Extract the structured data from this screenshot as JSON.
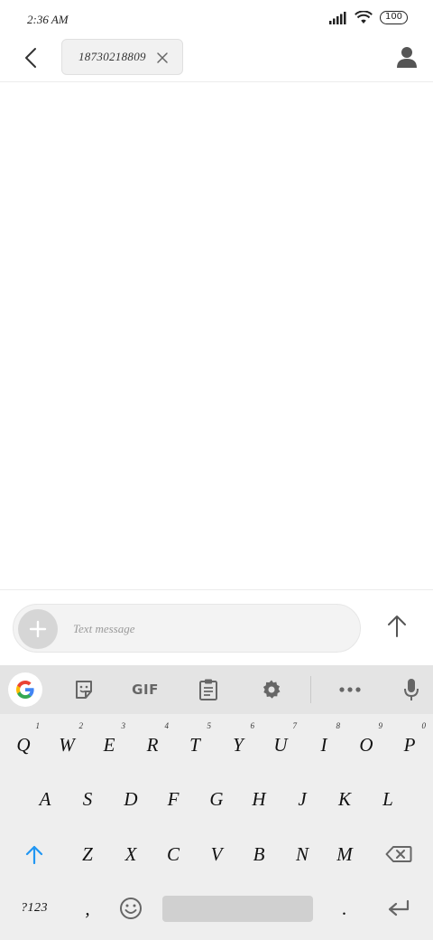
{
  "status_bar": {
    "time": "2:36 AM",
    "battery": "100",
    "icons": [
      "signal-icon",
      "wifi-icon",
      "battery-icon"
    ]
  },
  "header": {
    "recipient": "18730218809",
    "icons": [
      "back-arrow-icon",
      "close-icon",
      "contact-icon"
    ]
  },
  "compose": {
    "placeholder": "Text message",
    "value": "",
    "icons": [
      "plus-icon",
      "send-arrow-icon"
    ]
  },
  "keyboard": {
    "toolbar": {
      "gif_label": "GIF",
      "icons": [
        "google-icon",
        "sticker-icon",
        "clipboard-icon",
        "settings-icon",
        "more-icon",
        "mic-icon"
      ]
    },
    "row1": [
      {
        "label": "Q",
        "hint": "1"
      },
      {
        "label": "W",
        "hint": "2"
      },
      {
        "label": "E",
        "hint": "3"
      },
      {
        "label": "R",
        "hint": "4"
      },
      {
        "label": "T",
        "hint": "5"
      },
      {
        "label": "Y",
        "hint": "6"
      },
      {
        "label": "U",
        "hint": "7"
      },
      {
        "label": "I",
        "hint": "8"
      },
      {
        "label": "O",
        "hint": "9"
      },
      {
        "label": "P",
        "hint": "0"
      }
    ],
    "row2": [
      "A",
      "S",
      "D",
      "F",
      "G",
      "H",
      "J",
      "K",
      "L"
    ],
    "row3": [
      "Z",
      "X",
      "C",
      "V",
      "B",
      "N",
      "M"
    ],
    "row4": {
      "symbols_label": "?123",
      "comma": ",",
      "period": "."
    },
    "special_icons": [
      "shift-icon",
      "backspace-icon",
      "emoji-icon",
      "enter-icon"
    ],
    "accent_color": "#2196f3"
  }
}
